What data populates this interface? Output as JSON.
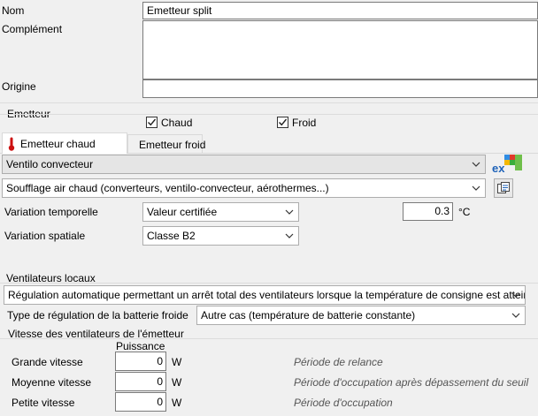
{
  "header": {
    "nom_label": "Nom",
    "nom_value": "Emetteur split",
    "complement_label": "Complément",
    "complement_value": "",
    "origine_label": "Origine",
    "origine_value": ""
  },
  "emetteur": {
    "group_label": "Emetteur",
    "chaud_label": "Chaud",
    "chaud_checked": true,
    "froid_label": "Froid",
    "froid_checked": true
  },
  "tabs": [
    {
      "label": "Emetteur chaud",
      "active": true
    },
    {
      "label": "Emetteur froid",
      "active": false
    }
  ],
  "main": {
    "type_value": "Ventilo convecteur",
    "soufflage_value": "Soufflage air chaud (converteurs, ventilo-convecteur, aérothermes...)",
    "variation_temporelle_label": "Variation temporelle",
    "variation_temporelle_value": "Valeur certifiée",
    "temperature_value": "0.3",
    "temperature_unit": "°C",
    "variation_spatiale_label": "Variation spatiale",
    "variation_spatiale_value": "Classe B2"
  },
  "ventilateurs": {
    "group_label": "Ventilateurs locaux",
    "regulation_value": "Régulation automatique permettant un arrêt total des ventilateurs lorsque la température de consigne est atteinte",
    "type_regulation_label": "Type de régulation de la batterie froide",
    "type_regulation_value": "Autre cas (température de batterie constante)"
  },
  "vitesse": {
    "group_label": "Vitesse des ventilateurs de l'émetteur",
    "puissance_header": "Puissance",
    "unit": "W",
    "rows": [
      {
        "label": "Grande vitesse",
        "value": "0",
        "period": "Période de relance"
      },
      {
        "label": "Moyenne vitesse",
        "value": "0",
        "period": "Période d'occupation après dépassement du seuil"
      },
      {
        "label": "Petite vitesse",
        "value": "0",
        "period": "Période d'occupation"
      }
    ]
  },
  "icons": {
    "excel_text": "ex",
    "thermometer_hot_color": "#cc1111",
    "thermometer_cold_color": "#17b8d8"
  }
}
